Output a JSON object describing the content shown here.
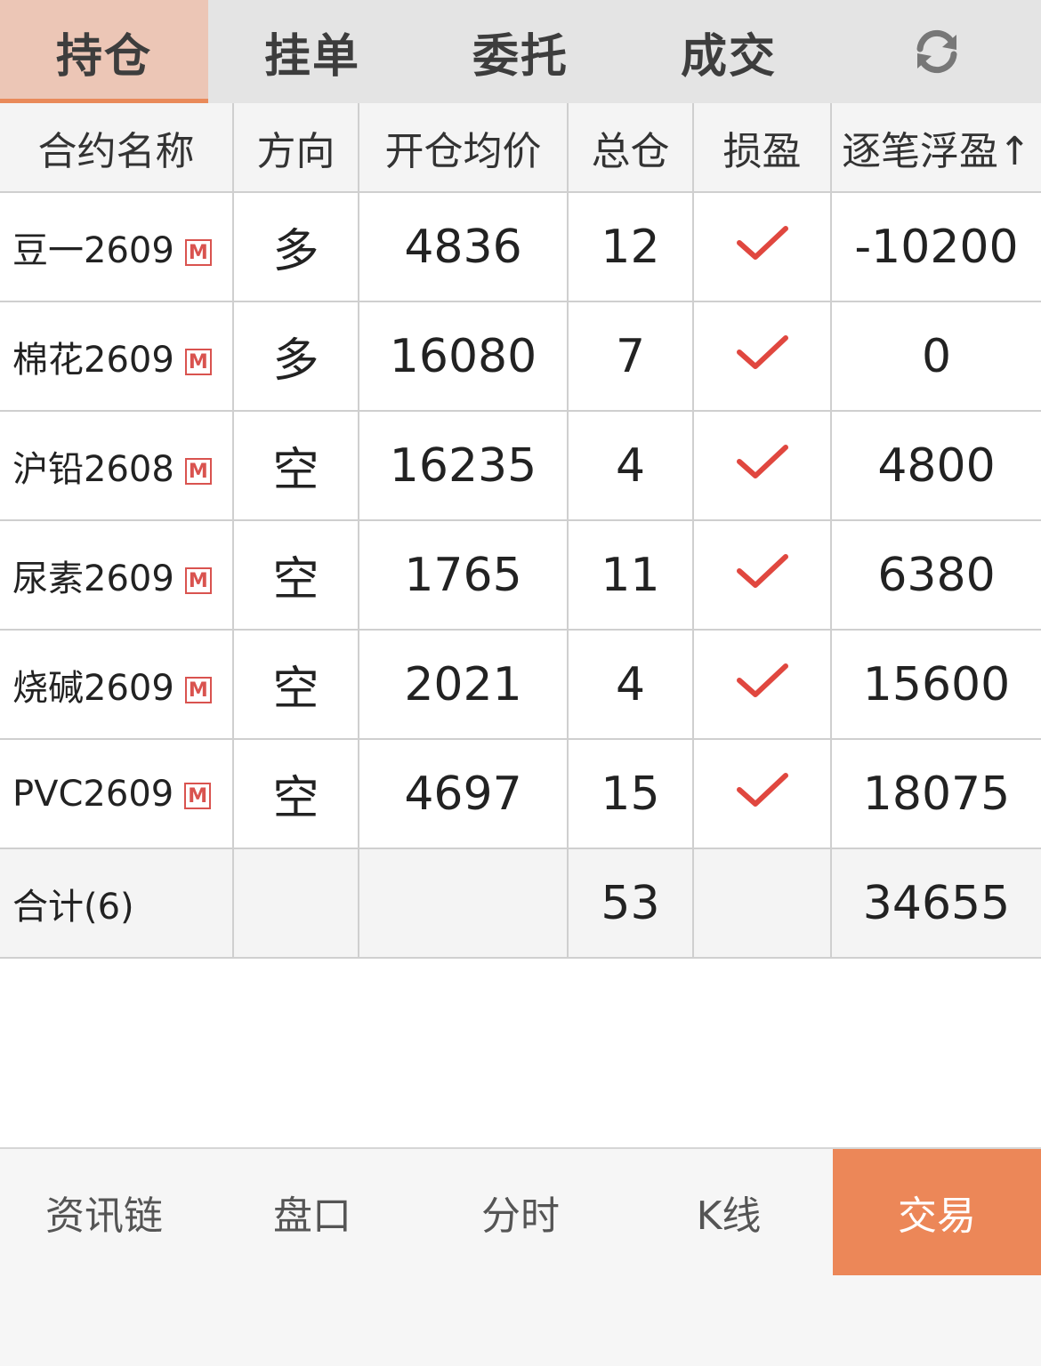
{
  "tabs": [
    {
      "label": "持仓"
    },
    {
      "label": "挂单"
    },
    {
      "label": "委托"
    },
    {
      "label": "成交"
    }
  ],
  "refresh_icon": "refresh-icon",
  "columns": [
    "合约名称",
    "方向",
    "开仓均价",
    "总仓",
    "损盈",
    "逐笔浮盈↑"
  ],
  "badge_text": "M",
  "rows": [
    {
      "name": "豆一2609",
      "direction": "多",
      "avg_price": "4836",
      "total": "12",
      "pl": "-10200"
    },
    {
      "name": "棉花2609",
      "direction": "多",
      "avg_price": "16080",
      "total": "7",
      "pl": "0"
    },
    {
      "name": "沪铅2608",
      "direction": "空",
      "avg_price": "16235",
      "total": "4",
      "pl": "4800"
    },
    {
      "name": "尿素2609",
      "direction": "空",
      "avg_price": "1765",
      "total": "11",
      "pl": "6380"
    },
    {
      "name": "烧碱2609",
      "direction": "空",
      "avg_price": "2021",
      "total": "4",
      "pl": "15600"
    },
    {
      "name": "PVC2609",
      "direction": "空",
      "avg_price": "4697",
      "total": "15",
      "pl": "18075"
    }
  ],
  "total_row": {
    "label": "合计(6)",
    "total": "53",
    "pl": "34655"
  },
  "bottom_nav": [
    {
      "label": "资讯链"
    },
    {
      "label": "盘口"
    },
    {
      "label": "分时"
    },
    {
      "label": "K线"
    },
    {
      "label": "交易"
    }
  ],
  "colors": {
    "accent": "#ec8758",
    "active_tab_bg": "#ecc6b6",
    "long": "#d9534f",
    "short": "#2e8b57",
    "profit": "#d9534f",
    "loss": "#2e8b57"
  }
}
